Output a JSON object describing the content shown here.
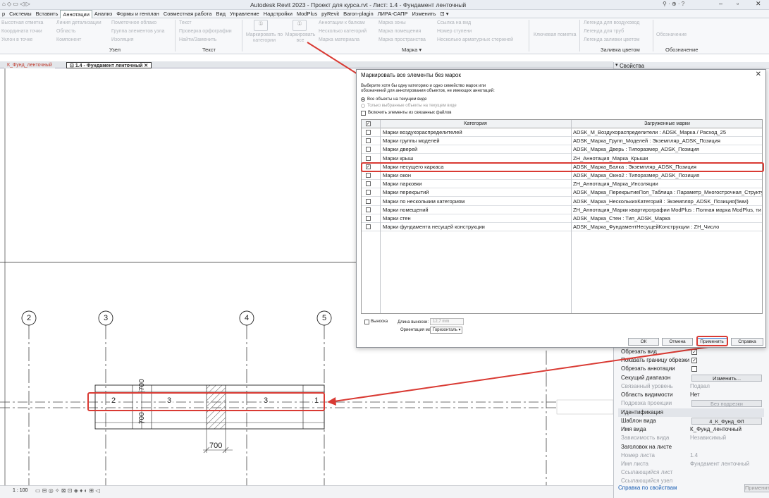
{
  "window": {
    "title": "Autodesk Revit 2023 - Проект для курса.rvt - Лист: 1.4 - Фундамент ленточный"
  },
  "menu": {
    "items": [
      "р",
      "Системы",
      "Вставить",
      "Аннотации",
      "Анализ",
      "Формы и генплан",
      "Совместная работа",
      "Вид",
      "Управление",
      "Надстройки",
      "ModPlus",
      "pyRevit",
      "Baron-plagin",
      "ЛИРА-САПР",
      "Изменить"
    ],
    "active": "Аннотации"
  },
  "ribbon": {
    "node_items": [
      "Высотная отметка",
      "Координата точки",
      "Уклон в точке",
      "Линия детализации",
      "Область",
      "Компонент",
      "Пометочное облако",
      "Группа элементов узла",
      "Изоляция"
    ],
    "text_items": [
      "Текст",
      "Проверка орфографии",
      "Найти/Заменить"
    ],
    "tag_big": [
      "Маркировать по категории",
      "Маркировать все"
    ],
    "tag_items": [
      "Аннотации к балкам",
      "Несколько категорий",
      "Марка материала",
      "Марка зоны",
      "Марка помещения",
      "Марка пространства",
      "Ссылка на вид",
      "Номер ступени",
      "Несколько арматурных стержней"
    ],
    "keynote": "Ключевая пометка",
    "legend_items": [
      "Легенда для воздуховод",
      "Легенда для труб",
      "Легенда заливки цветом"
    ],
    "symbol": "Обозначение",
    "groups": [
      "Узел",
      "Текст",
      "Марка",
      "Заливка цветом",
      "Обозначение"
    ]
  },
  "view_tabs": [
    {
      "label": "К_Фунд_ленточный",
      "active": false
    },
    {
      "label": "1.4 - Фундамент ленточный",
      "active": true
    }
  ],
  "drawing": {
    "grid_bubbles": [
      "2",
      "3",
      "4",
      "5"
    ],
    "tags": [
      "2",
      "3",
      "3",
      "1"
    ],
    "dim_700_top": "700",
    "dim_700_bottom": "700",
    "dim_700_horizontal": "700"
  },
  "status": {
    "scale": "1 : 100"
  },
  "properties": {
    "title": "Свойства",
    "rows_top": [
      {
        "key": "Обрезать вид",
        "type": "check",
        "checked": true
      },
      {
        "key": "Показать границу обрезки",
        "type": "check",
        "checked": true
      },
      {
        "key": "Обрезать аннотации",
        "type": "check",
        "checked": false
      },
      {
        "key": "Секущий диапазон",
        "type": "button",
        "value": "Изменить..."
      },
      {
        "key": "Связанный уровень",
        "type": "text",
        "value": "Подвал",
        "disabled": true
      },
      {
        "key": "Область видимости",
        "type": "text",
        "value": "Нет",
        "disabled": false
      },
      {
        "key": "Подрезка проекции",
        "type": "button",
        "value": "Без подрезки",
        "disabled": true
      }
    ],
    "section": "Идентификация",
    "rows_bottom": [
      {
        "key": "Шаблон вида",
        "type": "button",
        "value": "4_К_Фунд_ФЛ"
      },
      {
        "key": "Имя вида",
        "type": "text",
        "value": "К_Фунд_ленточный",
        "disabled": false
      },
      {
        "key": "Зависимость вида",
        "type": "text",
        "value": "Независимый",
        "disabled": true
      },
      {
        "key": "Заголовок на листе",
        "type": "text",
        "value": "",
        "disabled": false
      },
      {
        "key": "Номер листа",
        "type": "text",
        "value": "1.4",
        "disabled": true
      },
      {
        "key": "Имя листа",
        "type": "text",
        "value": "Фундамент ленточный",
        "disabled": true
      },
      {
        "key": "Ссылающийся лист",
        "type": "text",
        "value": "",
        "disabled": true
      },
      {
        "key": "Ссылающийся узел",
        "type": "text",
        "value": "",
        "disabled": true
      }
    ],
    "help_link": "Справка по свойствам",
    "apply_label": "Применить"
  },
  "dialog": {
    "title": "Маркировать все элементы без марок",
    "instruction_line1": "Выберите хотя бы одну категорию и одно семейство марок или",
    "instruction_line2": "обозначений для аннотирования объектов, не имеющих аннотаций:",
    "radio_all": "Все объекты на текущем виде",
    "radio_selected": "Только выбранные объекты на текущем виде",
    "include_linked": "Включить элементы из связанных файлов",
    "col_category": "Категория",
    "col_tags": "Загруженные марки",
    "rows": [
      {
        "category": "Марки воздухораспределителей",
        "tag": "ADSK_M_Воздухораспределители : ADSK_Марка / Расход_25",
        "checked": false
      },
      {
        "category": "Марки группы моделей",
        "tag": "ADSK_Марка_Групп_Моделей : Экземпляр_ADSK_Позиция",
        "checked": false
      },
      {
        "category": "Марки дверей",
        "tag": "ADSK_Марка_Дверь : Типоразмер_ADSK_Позиция",
        "checked": false
      },
      {
        "category": "Марки крыш",
        "tag": "ZH_Аннотация_Марка_Крыши",
        "checked": false
      },
      {
        "category": "Марки несущего каркаса",
        "tag": "ADSK_Марка_Балка : Экземпляр_ADSK_Позиция",
        "checked": true
      },
      {
        "category": "Марки окон",
        "tag": "ADSK_Марка_Окно2 : Типоразмер_ADSK_Позиция",
        "checked": false
      },
      {
        "category": "Марки парковки",
        "tag": "ZH_Аннотация_Марка_Инсоляции",
        "checked": false
      },
      {
        "category": "Марки перекрытий",
        "tag": "ADSK_Марка_ПерекрытиеПол_Таблица : Параметр_Многострочная_Структу",
        "checked": false
      },
      {
        "category": "Марки по нескольким категориям",
        "tag": "ADSK_Марка_НесколькихКатегорий : Экземпляр_ADSK_Позиция(5мм)",
        "checked": false
      },
      {
        "category": "Марки помещений",
        "tag": "ZH_Аннотация_Марки квартирографии ModPlus : Полная марка ModPlus, ти",
        "checked": false
      },
      {
        "category": "Марки стен",
        "tag": "ADSK_Марка_Стен : Тип_ADSK_Марка",
        "checked": false
      },
      {
        "category": "Марки фундамента несущей конструкции",
        "tag": "ADSK_Марка_ФундаментНесущейКонструкции : ZH_Число",
        "checked": false
      }
    ],
    "leader_label": "Выноска",
    "leader_length_label": "Длина выноски:",
    "leader_length_value": "12,7 mm",
    "orientation_label": "Ориентация марки:",
    "orientation_value": "Горизонталь",
    "buttons": {
      "ok": "ОК",
      "cancel": "Отмена",
      "apply": "Применить",
      "help": "Справка"
    }
  },
  "colors": {
    "highlight": "#d93a33",
    "accent": "#3c7fd6"
  }
}
